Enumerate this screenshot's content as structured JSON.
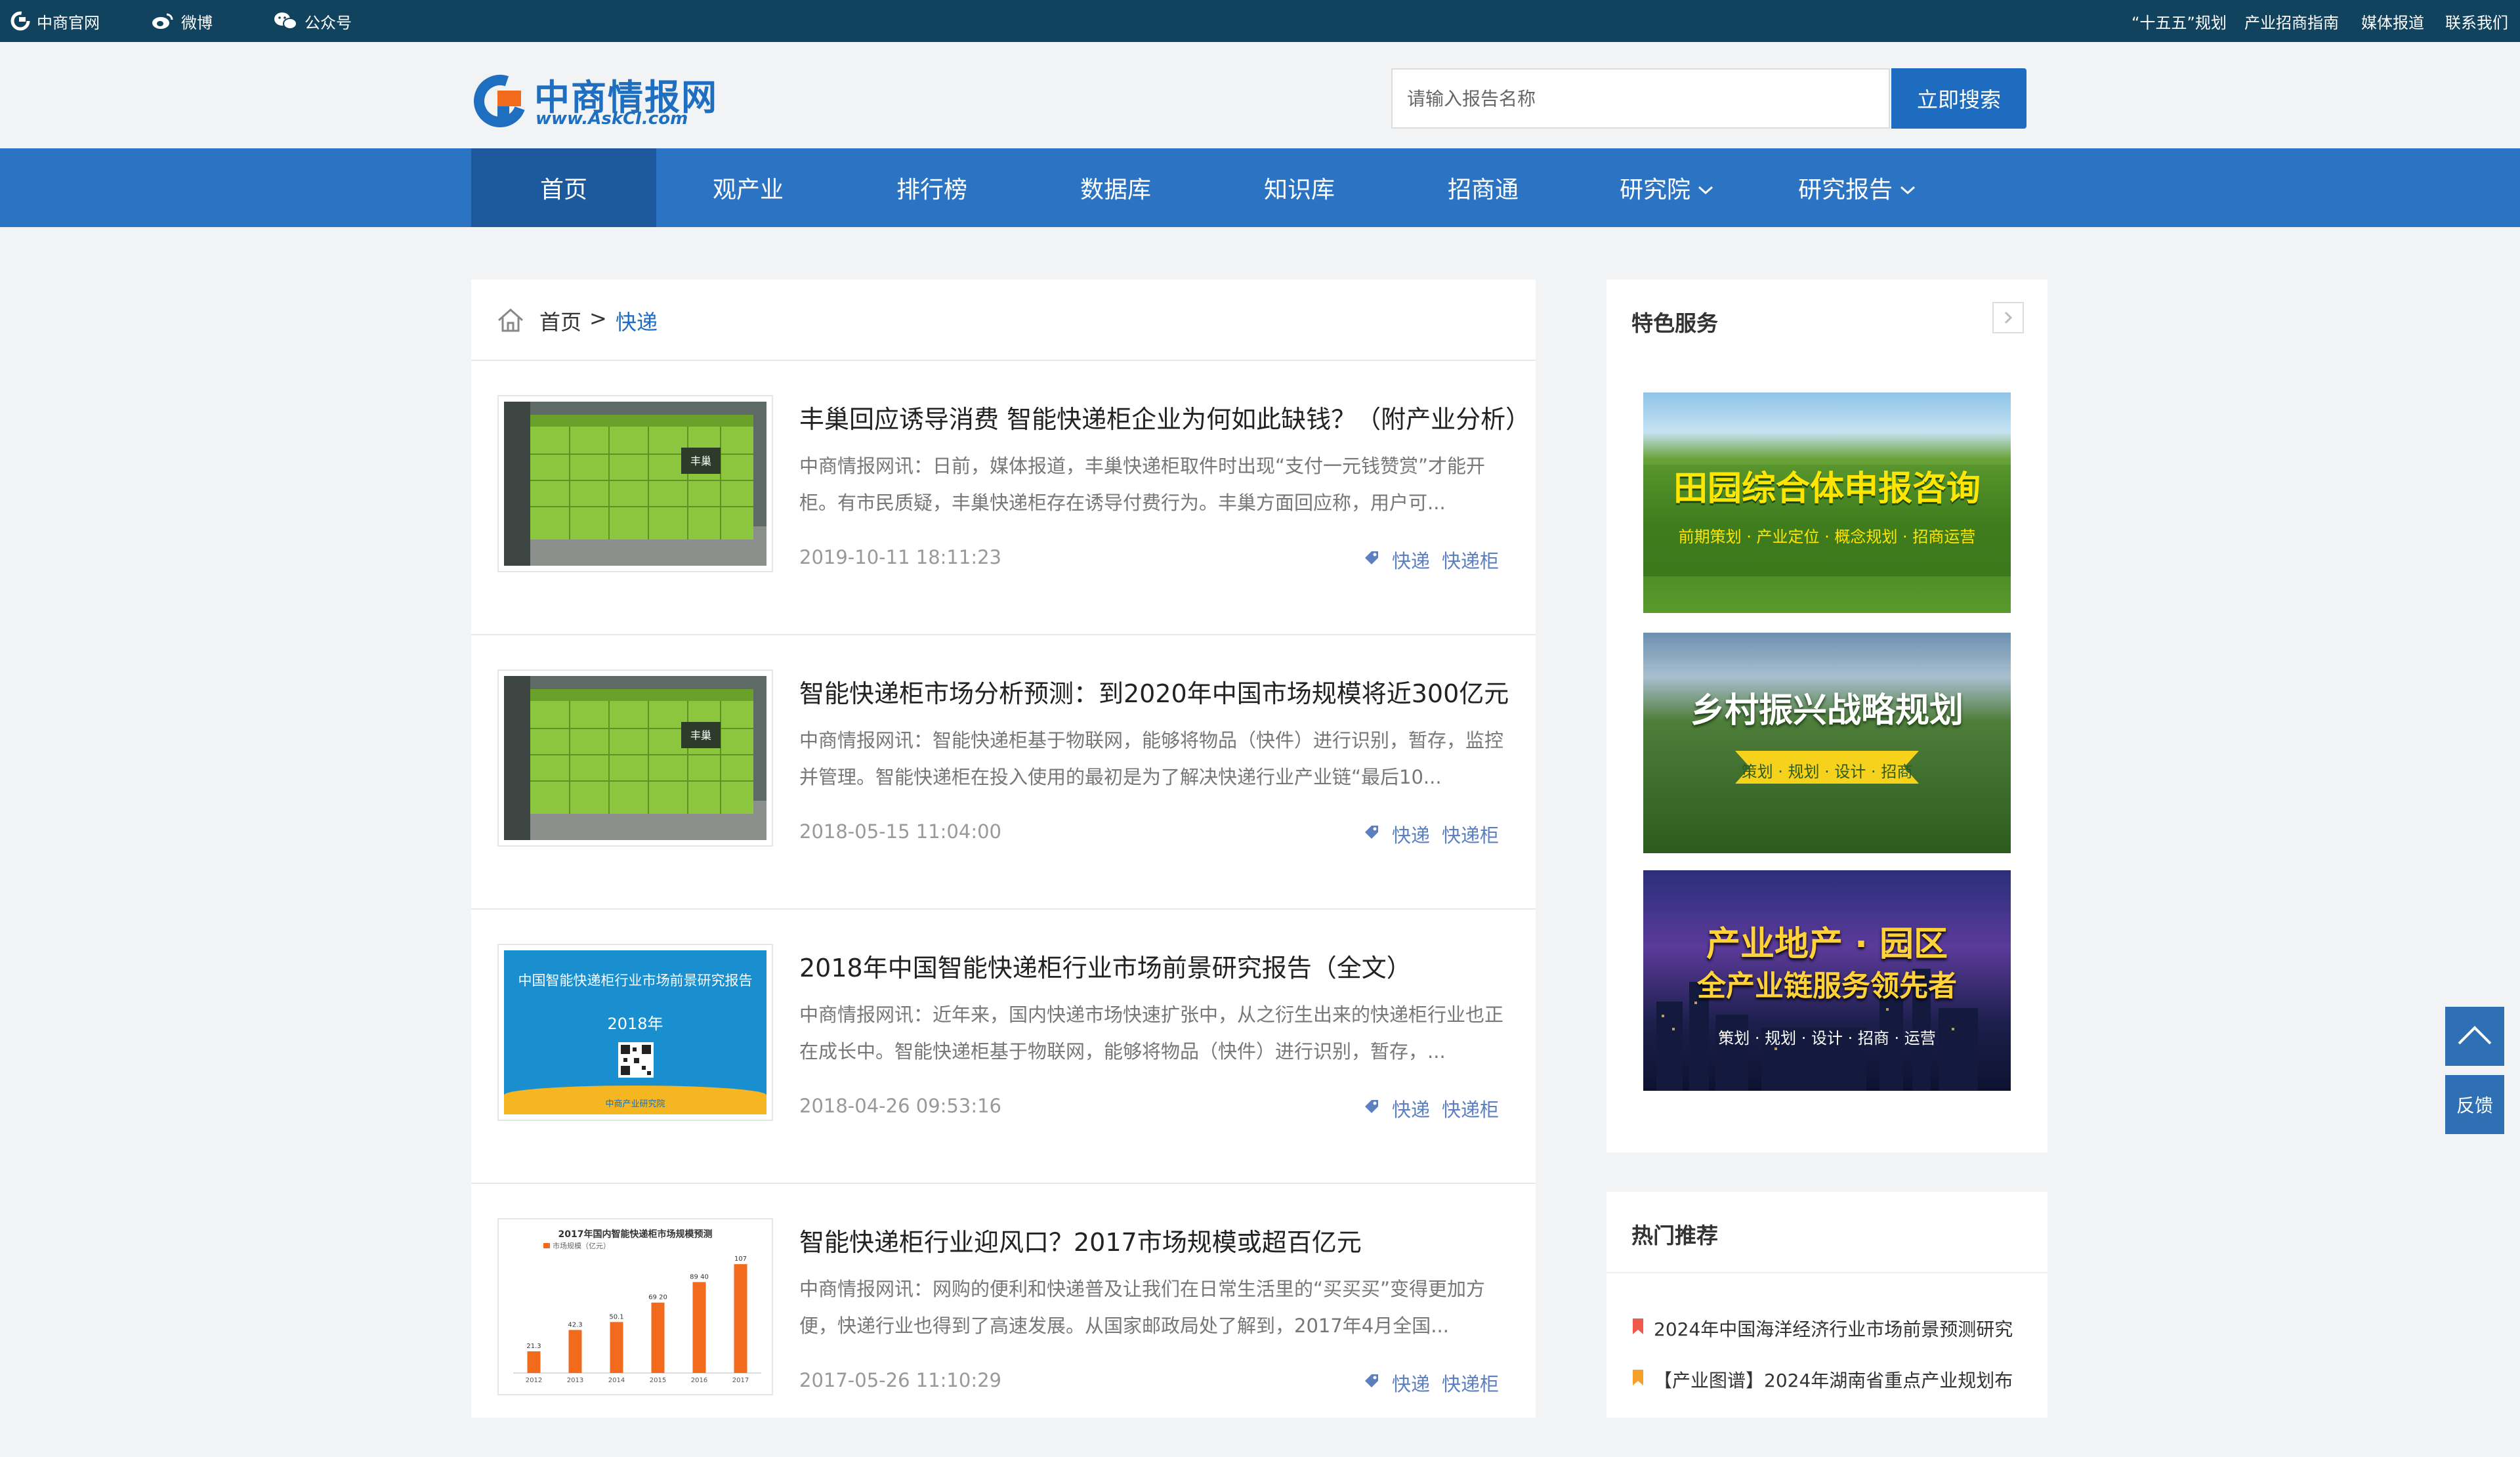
{
  "topbar": {
    "left_links": [
      {
        "label": "中商官网",
        "icon": "site-logo-icon"
      },
      {
        "label": "微博",
        "icon": "weibo-icon"
      },
      {
        "label": "公众号",
        "icon": "wechat-icon"
      }
    ],
    "right_links": [
      "“十五五”规划",
      "产业招商指南",
      "媒体报道",
      "联系我们"
    ]
  },
  "logo": {
    "cn": "中商情报网",
    "en": "www.AskCI.com"
  },
  "search": {
    "placeholder": "请输入报告名称",
    "value": "",
    "button_label": "立即搜索"
  },
  "nav": {
    "items": [
      {
        "label": "首页",
        "active": true
      },
      {
        "label": "观产业"
      },
      {
        "label": "排行榜"
      },
      {
        "label": "数据库"
      },
      {
        "label": "知识库"
      },
      {
        "label": "招商通"
      },
      {
        "label": "研究院",
        "dropdown": true
      },
      {
        "label": "研究报告",
        "dropdown": true
      }
    ]
  },
  "breadcrumb": {
    "home": "首页",
    "separator": ">",
    "current": "快递"
  },
  "articles": [
    {
      "title": "丰巢回应诱导消费 智能快递柜企业为何如此缺钱？（附产业分析）",
      "summary": "中商情报网讯：日前，媒体报道，丰巢快递柜取件时出现“支付一元钱赞赏”才能开柜。有市民质疑，丰巢快递柜存在诱导付费行为。丰巢方面回应称，用户可...",
      "date": "2019-10-11 18:11:23",
      "tags": [
        "快递",
        "快递柜"
      ],
      "thumb": {
        "type": "locker-photo",
        "brand": "丰巢"
      }
    },
    {
      "title": "智能快递柜市场分析预测：到2020年中国市场规模将近300亿元",
      "summary": "中商情报网讯：智能快递柜基于物联网，能够将物品（快件）进行识别，暂存，监控并管理。智能快递柜在投入使用的最初是为了解决快递行业产业链“最后10...",
      "date": "2018-05-15 11:04:00",
      "tags": [
        "快递",
        "快递柜"
      ],
      "thumb": {
        "type": "locker-photo",
        "brand": "丰巢"
      }
    },
    {
      "title": "2018年中国智能快递柜行业市场前景研究报告（全文）",
      "summary": "中商情报网讯：近年来，国内快递市场快速扩张中，从之衍生出来的快递柜行业也正在成长中。智能快递柜基于物联网，能够将物品（快件）进行识别，暂存，...",
      "date": "2018-04-26 09:53:16",
      "tags": [
        "快递",
        "快递柜"
      ],
      "thumb": {
        "type": "report-cover",
        "cover_title": "中国智能快递柜行业市场前景研究报告",
        "cover_year": "2018年",
        "cover_footer": "中商产业研究院"
      }
    },
    {
      "title": "智能快递柜行业迎风口？2017市场规模或超百亿元",
      "summary": "中商情报网讯：网购的便利和快递普及让我们在日常生活里的“买买买”变得更加方便，快递行业也得到了高速发展。从国家邮政局处了解到，2017年4月全国...",
      "date": "2017-05-26 11:10:29",
      "tags": [
        "快递",
        "快递柜"
      ],
      "thumb": {
        "type": "mini-bar-chart"
      }
    }
  ],
  "chart_thumb": {
    "title": "2017年国内智能快递柜市场规模预测",
    "legend": "市场规模（亿元）",
    "categories": [
      "2012",
      "2013",
      "2014",
      "2015",
      "2016",
      "2017"
    ],
    "values": [
      21.3,
      42.3,
      50.1,
      69.2,
      89.4,
      107
    ],
    "value_labels": [
      "21.3",
      "42.3",
      "50.1",
      "69 20",
      "89 40",
      "107"
    ],
    "bar_color": "#f26a1b"
  },
  "sidebar": {
    "special_title": "特色服务",
    "banners": [
      {
        "title": "田园综合体申报咨询",
        "subtitle": "前期策划 · 产业定位 · 概念规划 · 招商运营"
      },
      {
        "title": "乡村振兴战略规划",
        "subtitle": "策划 · 规划 · 设计 · 招商"
      },
      {
        "title": "产业地产 · 园区",
        "title2": "全产业链服务领先者",
        "subtitle": "策划 · 规划 · 设计 · 招商 · 运营"
      }
    ],
    "hot_title": "热门推荐",
    "hot_items": [
      {
        "label": "2024年中国海洋经济行业市场前景预测研究",
        "color": "#f05a4b"
      },
      {
        "label": "【产业图谱】2024年湖南省重点产业规划布",
        "color": "#f5a028"
      }
    ]
  },
  "floating": {
    "top_icon": "back-to-top-icon",
    "feedback_label": "反馈"
  },
  "colors": {
    "topbar": "#11425e",
    "nav": "#2b73c3",
    "nav_active": "#1c5a9d",
    "accent": "#1e6cc0",
    "tag": "#5c7fc0"
  }
}
